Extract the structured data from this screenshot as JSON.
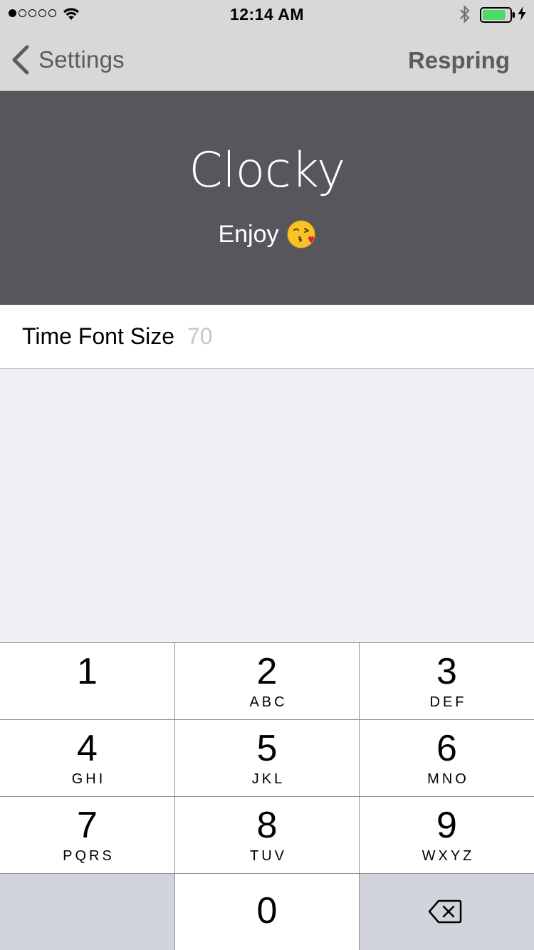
{
  "status_bar": {
    "time": "12:14 AM",
    "signal_bars_filled": 1,
    "signal_bars_total": 5,
    "battery_level": 0.85,
    "icons": [
      "signal-dots",
      "wifi-icon",
      "bluetooth-icon",
      "battery-icon",
      "charging-bolt-icon"
    ]
  },
  "nav": {
    "back_label": "Settings",
    "action_label": "Respring"
  },
  "banner": {
    "title": "Clocky",
    "subtitle": "Enjoy",
    "emoji": "kissing-face-with-heart",
    "background": "#57565c"
  },
  "settings": {
    "row_label": "Time Font Size",
    "row_placeholder": "70",
    "row_value": ""
  },
  "keypad": {
    "keys": [
      {
        "num": "1",
        "letters": ""
      },
      {
        "num": "2",
        "letters": "ABC"
      },
      {
        "num": "3",
        "letters": "DEF"
      },
      {
        "num": "4",
        "letters": "GHI"
      },
      {
        "num": "5",
        "letters": "JKL"
      },
      {
        "num": "6",
        "letters": "MNO"
      },
      {
        "num": "7",
        "letters": "PQRS"
      },
      {
        "num": "8",
        "letters": "TUV"
      },
      {
        "num": "9",
        "letters": "WXYZ"
      },
      {
        "num": "0",
        "letters": ""
      }
    ],
    "backspace_icon": "backspace-icon"
  },
  "colors": {
    "nav_bg": "#d8d8d8",
    "nav_text": "#5b5b60",
    "page_bg": "#efeff4",
    "key_dark": "#d1d5db",
    "battery_green": "#4cd964"
  }
}
